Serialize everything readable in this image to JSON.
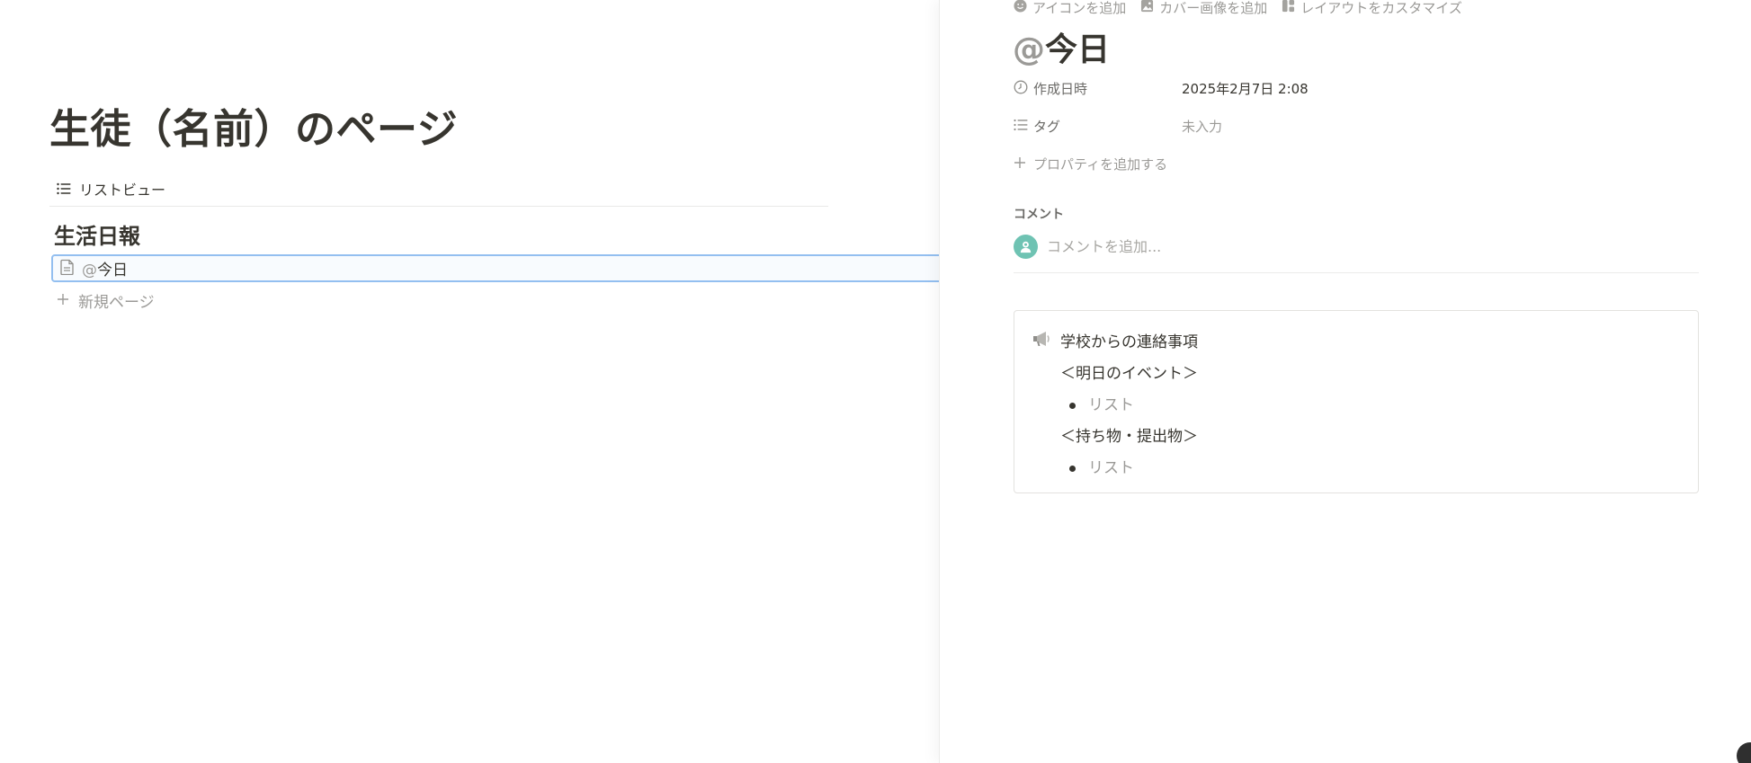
{
  "left": {
    "page_title": "生徒（名前）のページ",
    "view_tab_label": "リストビュー",
    "database_title": "生活日報",
    "row": {
      "prefix": "@",
      "title": "今日"
    },
    "new_page_label": "新規ページ"
  },
  "panel": {
    "actions": {
      "add_icon": "アイコンを追加",
      "add_cover": "カバー画像を追加",
      "customize_layout": "レイアウトをカスタマイズ"
    },
    "title_prefix": "@",
    "title": "今日",
    "properties": [
      {
        "name": "作成日時",
        "value": "2025年2月7日 2:08",
        "icon": "clock-icon"
      },
      {
        "name": "タグ",
        "value": "未入力",
        "icon": "list-icon"
      }
    ],
    "add_property_label": "プロパティを追加する",
    "comment_label": "コメント",
    "comment_placeholder": "コメントを追加...",
    "callout": {
      "icon": "megaphone-icon",
      "heading": "学校からの連絡事項",
      "section1": "＜明日のイベント＞",
      "bullet1": "リスト",
      "section2": "＜持ち物・提出物＞",
      "bullet2": "リスト"
    }
  },
  "colors": {
    "text": "#37352f",
    "muted": "#9b9a97",
    "selection_border": "#93bff0",
    "avatar": "#6fc3b3"
  }
}
